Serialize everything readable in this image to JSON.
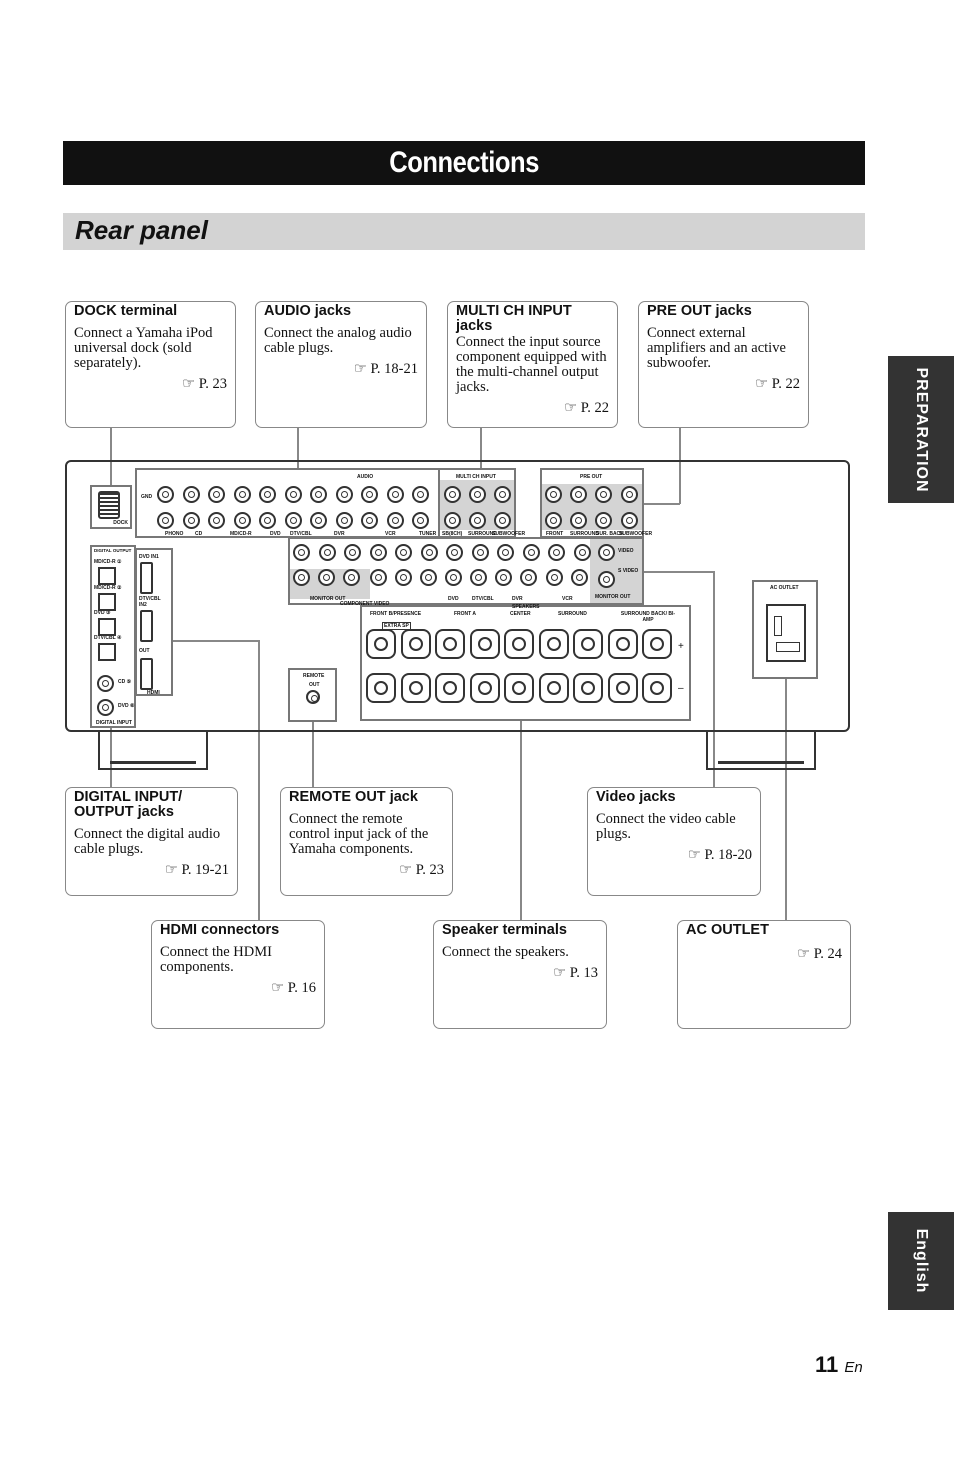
{
  "title": "Connections",
  "section": "Rear panel",
  "side_tabs": {
    "top": "PREPARATION",
    "bottom": "English"
  },
  "page": {
    "number": "11",
    "lang": "En"
  },
  "callouts": {
    "dock": {
      "title": "DOCK terminal",
      "text": "Connect a Yamaha iPod universal dock (sold separately).",
      "ref": "☞ P. 23"
    },
    "audio": {
      "title": "AUDIO jacks",
      "text": "Connect the analog audio cable plugs.",
      "ref": "☞ P. 18-21"
    },
    "multi": {
      "title": "MULTI CH INPUT jacks",
      "text": "Connect the input source component equipped with the multi-channel output jacks.",
      "ref": "☞ P. 22"
    },
    "preout": {
      "title": "PRE OUT jacks",
      "text": "Connect external amplifiers and an active subwoofer.",
      "ref": "☞ P. 22"
    },
    "digital": {
      "title": "DIGITAL INPUT/ OUTPUT jacks",
      "text": "Connect the digital audio cable plugs.",
      "ref": "☞ P. 19-21"
    },
    "remote": {
      "title": "REMOTE OUT jack",
      "text": "Connect the remote control input jack of the Yamaha components.",
      "ref": "☞ P. 23"
    },
    "video": {
      "title": "Video jacks",
      "text": "Connect the video cable plugs.",
      "ref": "☞ P. 18-20"
    },
    "hdmi": {
      "title": "HDMI connectors",
      "text": "Connect the HDMI components.",
      "ref": "☞ P. 16"
    },
    "speaker": {
      "title": "Speaker terminals",
      "text": "Connect the speakers.",
      "ref": "☞ P. 13"
    },
    "ac": {
      "title": "AC OUTLET",
      "text": "",
      "ref": "☞ P. 24"
    }
  },
  "panel": {
    "dock": "DOCK",
    "gnd": "GND",
    "audio": "AUDIO",
    "multi": "MULTI CH INPUT",
    "preout": "PRE OUT",
    "audio_labels": [
      "PHONO",
      "CD",
      "MD/CD-R",
      "DVD",
      "DTV/CBL",
      "DVR",
      "VCR",
      "TUNER"
    ],
    "multi_labels": [
      "SB(8CH)",
      "SURROUND",
      "SUBWOOFER"
    ],
    "preout_labels": [
      "FRONT",
      "SURROUND",
      "SUR. BACK",
      "SUBWOOFER"
    ],
    "video_labels": [
      "VIDEO",
      "S VIDEO",
      "MONITOR OUT",
      "COMPONENT VIDEO",
      "DVD",
      "DTV/CBL",
      "DVR",
      "VCR",
      "MONITOR OUT"
    ],
    "speakers": "SPEAKERS",
    "speaker_labels": [
      "FRONT B/PRESENCE",
      "FRONT A",
      "CENTER",
      "SURROUND",
      "SURROUND BACK/ BI-AMP"
    ],
    "extra_sp": "EXTRA SP",
    "remote": "REMOTE",
    "remote_out": "OUT",
    "digital_output": "DIGITAL OUTPUT",
    "digital_input": "DIGITAL INPUT",
    "digital_labels": [
      "MD/CD-R ①",
      "MD/CD-R ②",
      "DVD ③",
      "DTV/CBL ④",
      "CD ⑤",
      "DVD ⑥"
    ],
    "hdmi": "HDMI",
    "hdmi_labels": [
      "DVD IN1",
      "DTV/CBL IN2",
      "OUT"
    ],
    "ac_outlet": "AC OUTLET"
  }
}
